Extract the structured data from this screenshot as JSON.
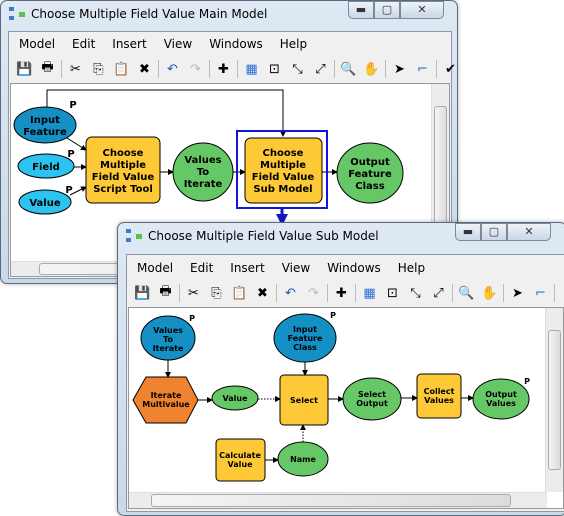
{
  "main_window": {
    "title": "Choose Multiple Field Value Main Model",
    "menu": [
      "Model",
      "Edit",
      "Insert",
      "View",
      "Windows",
      "Help"
    ],
    "toolbar": [
      "save-icon",
      "print-icon",
      "cut-icon",
      "copy-icon",
      "paste-icon",
      "delete-icon",
      "undo-icon",
      "redo-icon",
      "add-data-icon",
      "auto-layout-icon",
      "full-extent-icon",
      "zoom-in-fixed-icon",
      "zoom-out-fixed-icon",
      "zoom-icon",
      "pan-icon",
      "select-icon",
      "connect-icon",
      "validate-icon"
    ],
    "nodes": {
      "input_feature": [
        "Input",
        "Feature"
      ],
      "field": "Field",
      "value": "Value",
      "script_tool": [
        "Choose",
        "Multiple",
        "Field Value",
        "Script Tool"
      ],
      "values_to_iterate": [
        "Values",
        "To",
        "Iterate"
      ],
      "sub_model": [
        "Choose",
        "Multiple",
        "Field Value",
        "Sub Model"
      ],
      "output": [
        "Output",
        "Feature",
        "Class"
      ],
      "p": "P"
    }
  },
  "sub_window": {
    "title": "Choose Multiple Field Value Sub Model",
    "menu": [
      "Model",
      "Edit",
      "Insert",
      "View",
      "Windows",
      "Help"
    ],
    "nodes": {
      "values_to_iterate": [
        "Values",
        "To",
        "Iterate"
      ],
      "iterate": [
        "Iterate",
        "Multivalue"
      ],
      "value": "Value",
      "input_fc": [
        "Input",
        "Feature",
        "Class"
      ],
      "select": "Select",
      "select_output": [
        "Select",
        "Output"
      ],
      "collect": [
        "Collect",
        "Values"
      ],
      "output_values": [
        "Output",
        "Values"
      ],
      "calculate": [
        "Calculate",
        "Value"
      ],
      "name": "Name",
      "p": "P"
    }
  },
  "colors": {
    "input_dark": "#1590c4",
    "input_light": "#2bc3ef",
    "tool": "#fdc936",
    "derived": "#66c766",
    "iterator": "#f0832f",
    "selection": "#1414e0"
  }
}
